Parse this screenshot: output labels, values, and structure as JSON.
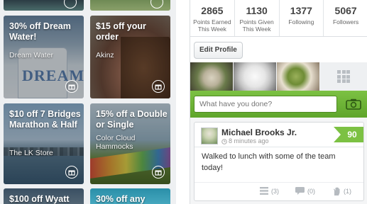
{
  "deals": [
    {
      "title": "30% off Dream Water!",
      "brand": "Dream Water",
      "bottle_text": "DREAM"
    },
    {
      "title": "$15 off your order",
      "brand": "Akinz"
    },
    {
      "title": "$10 off 7 Bridges Marathon & Half",
      "brand": "The LK Store"
    },
    {
      "title": "15% off a Double or Single",
      "brand": "Color Cloud Hammocks"
    },
    {
      "title": "$100 off Wyatt",
      "brand": ""
    },
    {
      "title": "30% off any",
      "brand": ""
    }
  ],
  "profile": {
    "stats": [
      {
        "value": "2865",
        "label": "Points Earned This Week"
      },
      {
        "value": "1130",
        "label": "Points Given This Week"
      },
      {
        "value": "1377",
        "label": "Following"
      },
      {
        "value": "5067",
        "label": "Followers"
      }
    ],
    "edit_button": "Edit Profile",
    "post_placeholder": "What have you done?",
    "post": {
      "user": "Michael Brooks Jr.",
      "time": "8 minutes ago",
      "points": "90",
      "text": "Walked to lunch with some of the team today!",
      "list_count": "(3)",
      "comment_count": "(0)",
      "like_count": "(1)"
    }
  },
  "colors": {
    "accent_green": "#7cc143"
  },
  "icons": [
    "gift-icon",
    "grid-icon",
    "camera-icon",
    "clock-icon",
    "list-icon",
    "comment-icon",
    "hand-icon"
  ]
}
